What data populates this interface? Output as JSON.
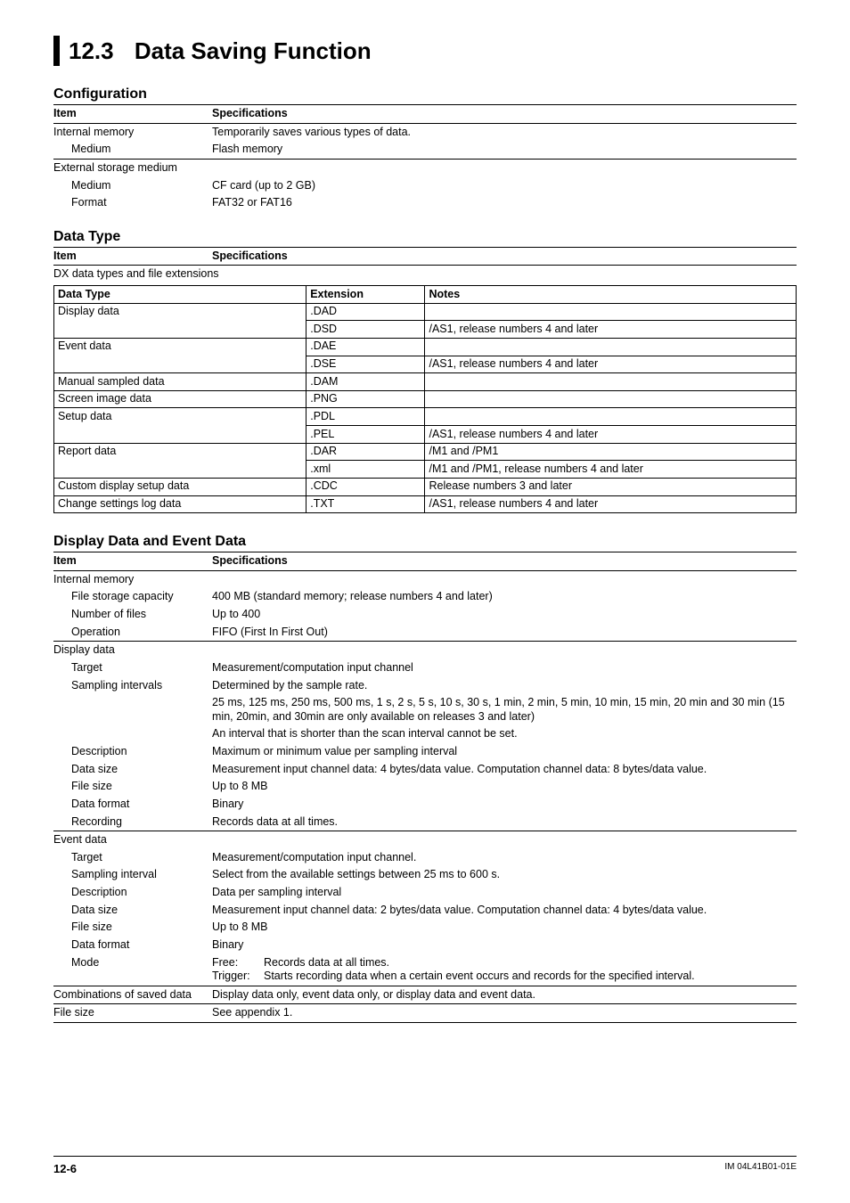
{
  "title": {
    "num": "12.3",
    "text": "Data Saving Function"
  },
  "sections": {
    "config": {
      "heading": "Configuration",
      "headers": {
        "item": "Item",
        "spec": "Specifications"
      },
      "rows": {
        "internal_memory": {
          "label": "Internal memory",
          "value": "Temporarily saves various types of data."
        },
        "medium1": {
          "label": "Medium",
          "value": "Flash memory"
        },
        "external": {
          "label": "External storage medium",
          "value": ""
        },
        "medium2": {
          "label": "Medium",
          "value": "CF card (up to 2 GB)"
        },
        "format": {
          "label": "Format",
          "value": "FAT32 or FAT16"
        }
      }
    },
    "datatype": {
      "heading": "Data Type",
      "headers": {
        "item": "Item",
        "spec": "Specifications",
        "dt": "Data Type",
        "ext": "Extension",
        "notes": "Notes"
      },
      "subhead": "DX data types and file extensions",
      "rows": [
        {
          "dt": "Display data",
          "ext": ".DAD",
          "notes": ""
        },
        {
          "dt": "",
          "ext": ".DSD",
          "notes": "/AS1, release numbers 4 and later"
        },
        {
          "dt": "Event data",
          "ext": ".DAE",
          "notes": ""
        },
        {
          "dt": "",
          "ext": ".DSE",
          "notes": "/AS1, release numbers 4 and later"
        },
        {
          "dt": "Manual sampled data",
          "ext": ".DAM",
          "notes": ""
        },
        {
          "dt": "Screen image data",
          "ext": ".PNG",
          "notes": ""
        },
        {
          "dt": "Setup data",
          "ext": ".PDL",
          "notes": ""
        },
        {
          "dt": "",
          "ext": ".PEL",
          "notes": "/AS1, release numbers 4 and later"
        },
        {
          "dt": "Report data",
          "ext": ".DAR",
          "notes": "/M1 and /PM1"
        },
        {
          "dt": "",
          "ext": ".xml",
          "notes": "/M1 and /PM1, release numbers 4 and later"
        },
        {
          "dt": "Custom display setup data",
          "ext": ".CDC",
          "notes": "Release numbers 3 and later"
        },
        {
          "dt": "Change settings log data",
          "ext": ".TXT",
          "notes": "/AS1, release numbers 4 and later"
        }
      ]
    },
    "display": {
      "heading": "Display Data and Event Data",
      "headers": {
        "item": "Item",
        "spec": "Specifications"
      },
      "groups": {
        "im": {
          "label": "Internal memory",
          "rows": {
            "fsc": {
              "label": "File storage capacity",
              "value": "400 MB (standard memory; release numbers 4 and later)"
            },
            "nof": {
              "label": "Number of files",
              "value": "Up to 400"
            },
            "op": {
              "label": "Operation",
              "value": "FIFO (First In First Out)"
            }
          }
        },
        "dd": {
          "label": "Display data",
          "rows": {
            "target": {
              "label": "Target",
              "value": "Measurement/computation input channel"
            },
            "si": {
              "label": "Sampling intervals",
              "value": "Determined by the sample rate."
            },
            "si_n1": "25 ms, 125 ms, 250 ms, 500 ms, 1 s, 2 s, 5 s, 10 s, 30 s, 1 min, 2 min, 5 min, 10 min, 15 min, 20 min and 30 min (15 min, 20min, and 30min are only available on releases 3 and later)",
            "si_n2": "An interval that is shorter than the scan interval cannot be set.",
            "desc": {
              "label": "Description",
              "value": "Maximum or minimum value per sampling interval"
            },
            "ds": {
              "label": "Data size",
              "value": "Measurement input channel data: 4 bytes/data value. Computation channel data: 8 bytes/data value."
            },
            "fs": {
              "label": "File size",
              "value": "Up to 8 MB"
            },
            "df": {
              "label": "Data format",
              "value": "Binary"
            },
            "rec": {
              "label": "Recording",
              "value": "Records data at all times."
            }
          }
        },
        "ed": {
          "label": "Event data",
          "rows": {
            "target": {
              "label": "Target",
              "value": "Measurement/computation input channel."
            },
            "si": {
              "label": "Sampling interval",
              "value": "Select from the available settings between 25 ms to 600 s."
            },
            "desc": {
              "label": "Description",
              "value": "Data per sampling interval"
            },
            "ds": {
              "label": "Data size",
              "value": "Measurement input channel data: 2 bytes/data value. Computation channel data: 4 bytes/data value."
            },
            "fs": {
              "label": "File size",
              "value": "Up to 8 MB"
            },
            "df": {
              "label": "Data format",
              "value": "Binary"
            },
            "mode": {
              "label": "Mode",
              "free_l": "Free:",
              "free_v": "Records data at all times.",
              "trig_l": "Trigger:",
              "trig_v": "Starts recording data when a certain event occurs and records for the specified interval."
            }
          }
        },
        "combo": {
          "label": "Combinations of saved data",
          "value": "Display data only, event data only, or display data and event data."
        },
        "fsize": {
          "label": "File size",
          "value": "See appendix 1."
        }
      }
    }
  },
  "footer": {
    "page": "12-6",
    "doc": "IM 04L41B01-01E"
  }
}
